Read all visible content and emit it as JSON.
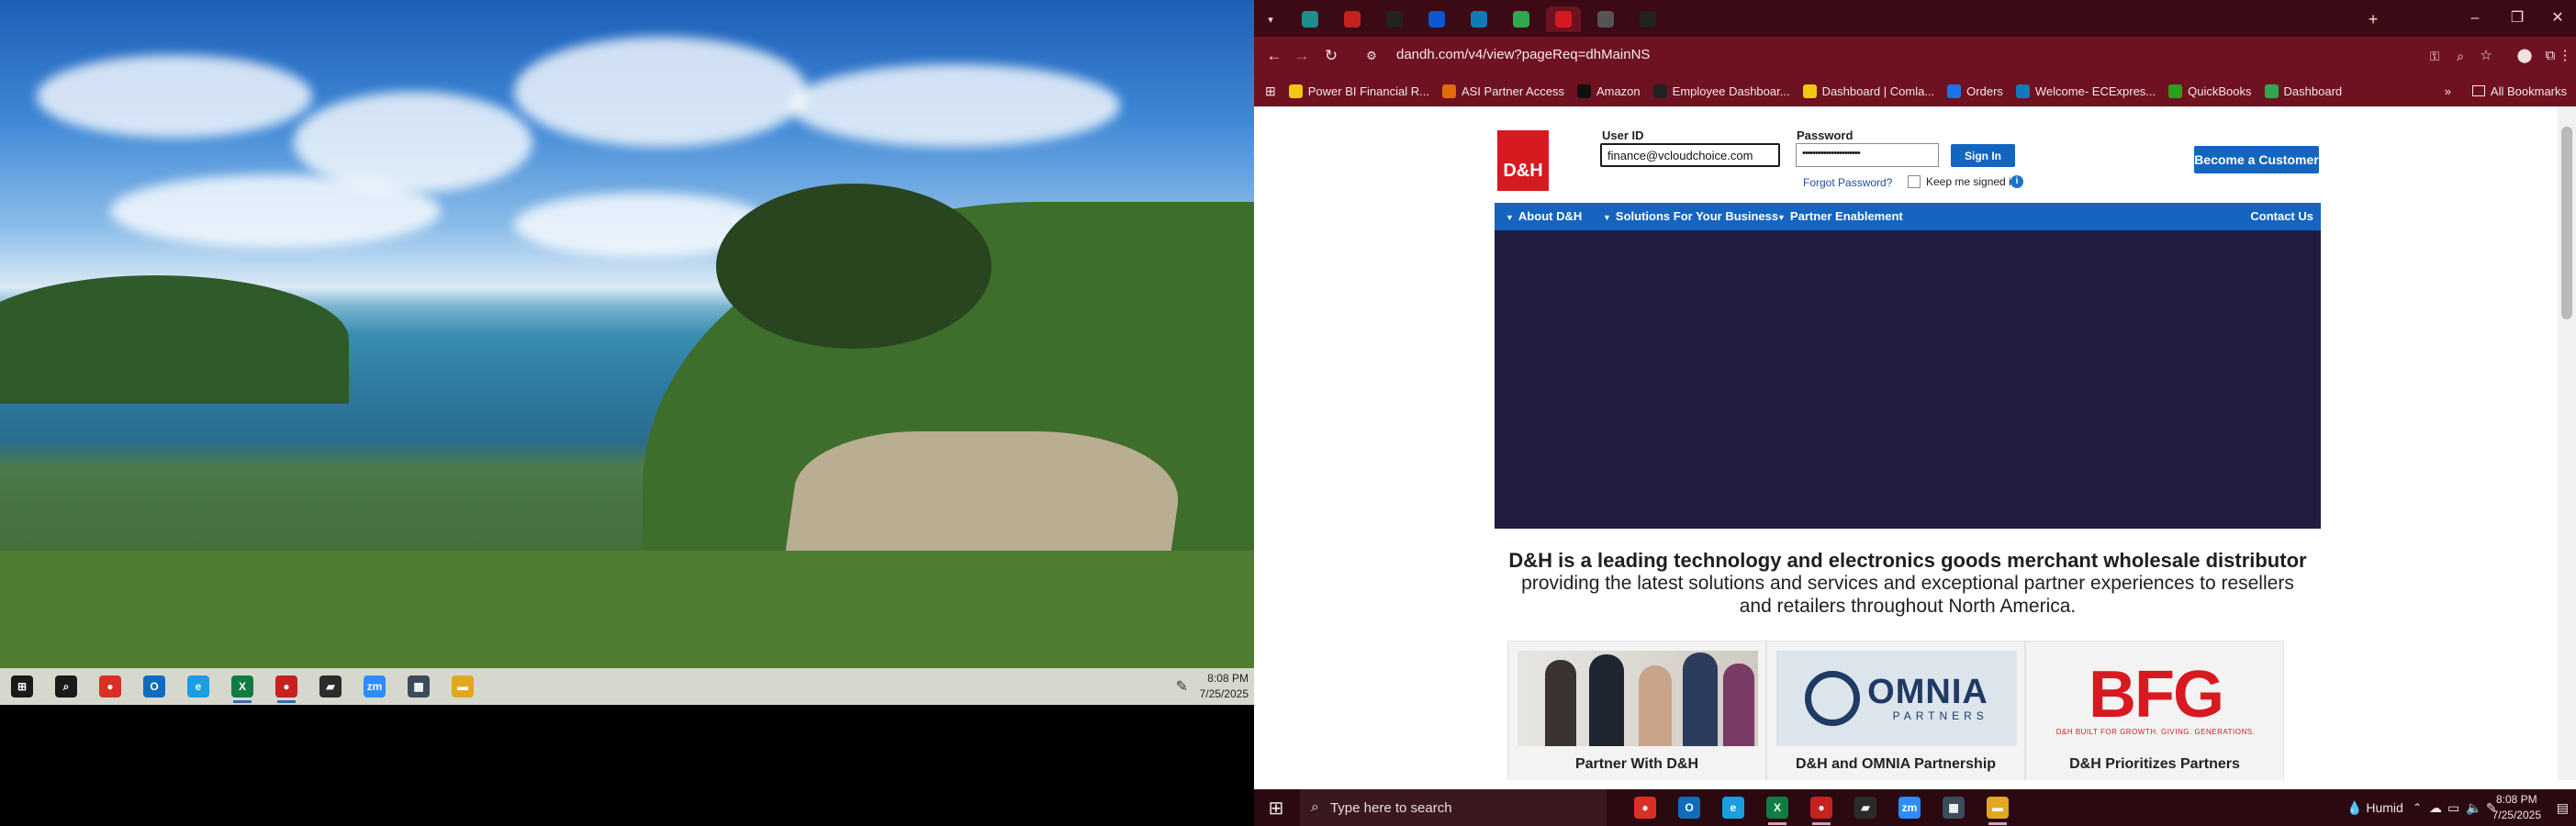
{
  "left_taskbar": {
    "apps": [
      {
        "name": "start-icon",
        "label": "⊞",
        "color": "#1a1a1a"
      },
      {
        "name": "search-icon",
        "label": "⌕",
        "color": "#1a1a1a"
      },
      {
        "name": "chrome-icon",
        "label": "●",
        "color": "#d93025"
      },
      {
        "name": "outlook-icon",
        "label": "O",
        "color": "#0f6cbd"
      },
      {
        "name": "edge-icon",
        "label": "e",
        "color": "#1b9de2"
      },
      {
        "name": "excel-icon",
        "label": "X",
        "color": "#107c41"
      },
      {
        "name": "chrome-profile-icon",
        "label": "●",
        "color": "#c5221f"
      },
      {
        "name": "sticky-notes-icon",
        "label": "▰",
        "color": "#2b2b2b"
      },
      {
        "name": "zoom-icon",
        "label": "zm",
        "color": "#2d8cff"
      },
      {
        "name": "calculator-icon",
        "label": "▦",
        "color": "#3b4b5b"
      },
      {
        "name": "file-explorer-icon",
        "label": "▬",
        "color": "#e2a720"
      }
    ],
    "time": "8:08 PM",
    "date": "7/25/2025"
  },
  "browser": {
    "url": "dandh.com/v4/view?pageReq=dhMainNS",
    "tab_colors": [
      "#1e8e8e",
      "#c5221f",
      "#222222",
      "#0b57d0",
      "#0f7ab8",
      "#2fa84f",
      "#d71920",
      "#555555",
      "#222222"
    ],
    "bookmarks": [
      {
        "label": "Power BI Financial R...",
        "color": "#f2c811"
      },
      {
        "label": "ASI Partner Access",
        "color": "#e26b0a"
      },
      {
        "label": "Amazon",
        "color": "#111111"
      },
      {
        "label": "Employee Dashboar...",
        "color": "#222222"
      },
      {
        "label": "Dashboard | Comla...",
        "color": "#f2c811"
      },
      {
        "label": "Orders",
        "color": "#1a73e8"
      },
      {
        "label": "Welcome- ECExpres...",
        "color": "#0f7ab8"
      },
      {
        "label": "QuickBooks",
        "color": "#2ca01c"
      },
      {
        "label": "Dashboard",
        "color": "#2fa84f"
      }
    ],
    "all_bookmarks": "All Bookmarks"
  },
  "page": {
    "logo": "D&H",
    "user_id_label": "User ID",
    "user_id_value": "finance@vcloudchoice.com",
    "password_label": "Password",
    "password_value": "••••••••••••••••••••••",
    "sign_in": "Sign In",
    "forgot_password": "Forgot Password?",
    "keep_signed_in": "Keep me signed in",
    "become_customer": "Become a Customer",
    "nav": [
      "About D&H",
      "Solutions For Your Business",
      "Partner Enablement"
    ],
    "contact": "Contact Us",
    "tagline_bold": "D&H is a leading technology and electronics goods merchant wholesale distributor",
    "tagline_rest": "providing the latest solutions and services and exceptional partner experiences to resellers and retailers throughout North America.",
    "cards": [
      {
        "title": "Partner With D&H"
      },
      {
        "title": "D&H and OMNIA Partnership",
        "logo_main": "OMNIA",
        "logo_sub": "PARTNERS"
      },
      {
        "title": "D&H Prioritizes Partners",
        "logo_main": "BFG",
        "logo_sub": "D&H BUILT FOR GROWTH. GIVING. GENERATIONS."
      }
    ]
  },
  "right_taskbar": {
    "search_placeholder": "Type here to search",
    "apps": [
      {
        "name": "chrome-icon",
        "label": "●",
        "color": "#d93025"
      },
      {
        "name": "outlook-icon",
        "label": "O",
        "color": "#0f6cbd"
      },
      {
        "name": "edge-icon",
        "label": "e",
        "color": "#1b9de2"
      },
      {
        "name": "excel-icon",
        "label": "X",
        "color": "#107c41"
      },
      {
        "name": "chrome-profile-icon",
        "label": "●",
        "color": "#c5221f"
      },
      {
        "name": "sticky-notes-icon",
        "label": "▰",
        "color": "#2b2b2b"
      },
      {
        "name": "zoom-icon",
        "label": "zm",
        "color": "#2d8cff"
      },
      {
        "name": "calculator-icon",
        "label": "▦",
        "color": "#3b4b5b"
      },
      {
        "name": "file-explorer-icon",
        "label": "▬",
        "color": "#e2a720"
      }
    ],
    "weather": "Humid",
    "time": "8:08 PM",
    "date": "7/25/2025"
  }
}
